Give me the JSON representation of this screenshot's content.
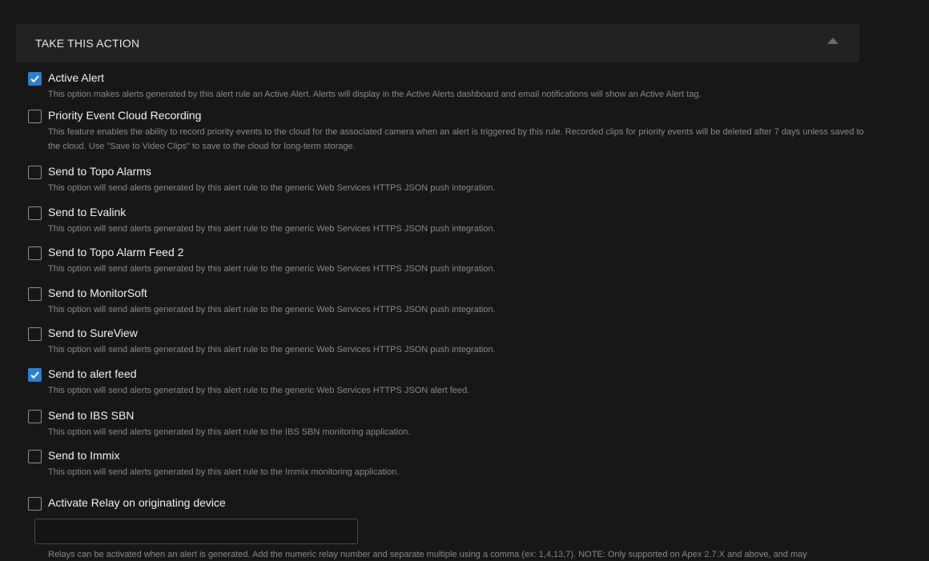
{
  "section": {
    "title": "TAKE THIS ACTION",
    "collapse_icon": "triangle-up-icon"
  },
  "colors": {
    "background": "#171717",
    "header_background": "#222222",
    "checkbox_checked": "#2d7fd1",
    "text": "#f2f2f2",
    "muted_text": "#888888"
  },
  "options": [
    {
      "label": "Active Alert",
      "checked": true,
      "description": "This option makes alerts generated by this alert rule an Active Alert. Alerts will display in the Active Alerts dashboard and email notifications will show an Active Alert tag."
    },
    {
      "label": "Priority Event Cloud Recording",
      "checked": false,
      "description": "This feature enables the ability to record priority events to the cloud for the associated camera when an alert is triggered by this rule. Recorded clips for priority events will be deleted after 7 days unless saved to the cloud. Use \"Save to Video Clips\" to save to the cloud for long-term storage."
    },
    {
      "label": "Send to Topo Alarms",
      "checked": false,
      "description": "This option will send alerts generated by this alert rule to the generic Web Services HTTPS JSON push integration."
    },
    {
      "label": "Send to Evalink",
      "checked": false,
      "description": "This option will send alerts generated by this alert rule to the generic Web Services HTTPS JSON push integration."
    },
    {
      "label": "Send to Topo Alarm Feed 2",
      "checked": false,
      "description": "This option will send alerts generated by this alert rule to the generic Web Services HTTPS JSON push integration."
    },
    {
      "label": "Send to MonitorSoft",
      "checked": false,
      "description": "This option will send alerts generated by this alert rule to the generic Web Services HTTPS JSON push integration."
    },
    {
      "label": "Send to SureView",
      "checked": false,
      "description": "This option will send alerts generated by this alert rule to the generic Web Services HTTPS JSON push integration."
    },
    {
      "label": "Send to alert feed",
      "checked": true,
      "description": "This option will send alerts generated by this alert rule to the generic Web Services HTTPS JSON alert feed."
    },
    {
      "label": "Send to IBS SBN",
      "checked": false,
      "description": "This option will send alerts generated by this alert rule to the IBS SBN monitoring application."
    },
    {
      "label": "Send to Immix",
      "checked": false,
      "description": "This option will send alerts generated by this alert rule to the Immix monitoring application."
    },
    {
      "label": "Activate Relay on originating device",
      "checked": false,
      "description": ""
    }
  ],
  "relay": {
    "value": "",
    "placeholder": "",
    "note": "Relays can be activated when an alert is generated. Add the numeric relay number and separate multiple using a comma (ex: 1,4,13,7). NOTE: Only supported on Apex 2.7.X and above, and may"
  }
}
